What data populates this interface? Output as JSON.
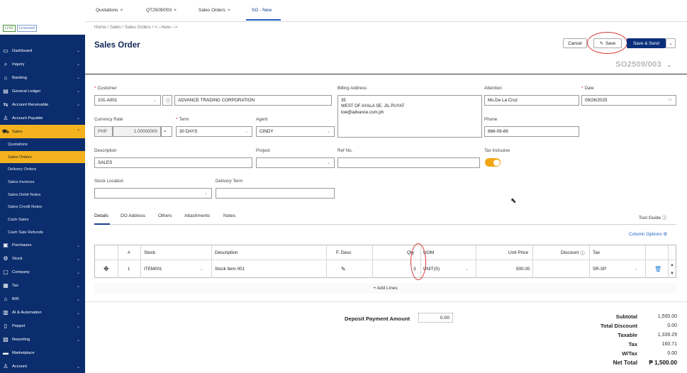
{
  "top_tabs": [
    {
      "label": "Quotations",
      "close": "×"
    },
    {
      "label": "QT2509/003",
      "close": "×"
    },
    {
      "label": "Sales Orders",
      "close": "×"
    },
    {
      "label": "SO - New"
    }
  ],
  "sidebar": {
    "badges": [
      "LIVE",
      "Licensed"
    ],
    "items": [
      {
        "label": "Dashboard",
        "icon": "dashboard-icon"
      },
      {
        "label": "Inquiry",
        "icon": "inquiry-icon"
      },
      {
        "label": "Banking",
        "icon": "bank-icon"
      },
      {
        "label": "General Ledger",
        "icon": "ledger-icon"
      },
      {
        "label": "Account Receivable",
        "icon": "receivable-icon"
      },
      {
        "label": "Account Payable",
        "icon": "payable-icon"
      },
      {
        "label": "Sales",
        "icon": "cart-icon"
      }
    ],
    "sales_sub": [
      "Quotations",
      "Sales Orders",
      "Delivery Orders",
      "Sales Invoices",
      "Sales Debit Notes",
      "Sales Credit Notes",
      "Cash Sales",
      "Cash Sale Refunds"
    ],
    "items_after": [
      {
        "label": "Purchases",
        "icon": "purchases-icon"
      },
      {
        "label": "Stock",
        "icon": "stock-icon"
      },
      {
        "label": "Company",
        "icon": "company-icon"
      },
      {
        "label": "Tax",
        "icon": "tax-icon"
      },
      {
        "label": "BIR",
        "icon": "bir-icon"
      },
      {
        "label": "AI & Automation",
        "icon": "automation-icon"
      },
      {
        "label": "Peppol",
        "icon": "peppol-icon"
      },
      {
        "label": "Reporting",
        "icon": "reporting-icon"
      },
      {
        "label": "Marketplace",
        "icon": "marketplace-icon"
      },
      {
        "label": "Account",
        "icon": "account-icon"
      }
    ]
  },
  "header": {
    "breadcrumb": "Home  /  Sales  /  Sales Orders  /  <---New--->",
    "title": "Sales Order",
    "cancel": "Cancel",
    "save": "Save",
    "save_send": "Save & Send",
    "doc_no": "SO2509/003"
  },
  "form": {
    "customer_label": "Customer",
    "customer_code": "101-A001",
    "customer_name": "ADVANCE TRADING CORPORATION",
    "billing_label": "Billing Address",
    "billing_lines": [
      "35",
      "WEST OF AYALA SE. JIL PUYAT",
      "low@advance.com.ph"
    ],
    "attention_label": "Attention",
    "attention": "Ms.De La Cruz",
    "date_label": "Date",
    "date": "09/26/2025",
    "currency_label": "Currency Rate",
    "currency": "PHP",
    "rate": "1.00000000",
    "term_label": "Term",
    "term": "30 DAYS",
    "agent_label": "Agent",
    "agent": "CINDY",
    "phone_label": "Phone",
    "phone": "866-09-89",
    "description_label": "Description",
    "description": "SALES",
    "project_label": "Project",
    "project": "",
    "refno_label": "Ref No.",
    "refno": "",
    "tax_inclusive_label": "Tax Inclusive",
    "tax_inclusive": true,
    "stock_location_label": "Stock Location",
    "stock_location": "",
    "delivery_term_label": "Delivery Term",
    "delivery_term": ""
  },
  "detail_tabs": [
    "Details",
    "DO Address",
    "Others",
    "Attachments",
    "Notes"
  ],
  "tool_guide": "Tool Guide",
  "column_options": "Column Options",
  "grid": {
    "headers": {
      "no": "#",
      "stock": "Stock",
      "description": "Description",
      "fdesc": "F. Desc",
      "qty": "Qty",
      "uom": "UOM",
      "unit_price": "Unit Price",
      "discount": "Discount",
      "tax": "Tax"
    },
    "rows": [
      {
        "no": "1",
        "stock": "ITEM001",
        "description": "Stock Item 001",
        "qty": "3",
        "uom": "UNIT(S)",
        "unit_price": "500.00",
        "discount": "",
        "tax": "SR-SP"
      }
    ],
    "add_lines": "+  Add Lines"
  },
  "deposit": {
    "label": "Deposit Payment Amount",
    "value": "0.00"
  },
  "totals": [
    {
      "label": "Subtotal",
      "value": "1,500.00"
    },
    {
      "label": "Total Discount",
      "value": "0.00"
    },
    {
      "label": "Taxable",
      "value": "1,339.29"
    },
    {
      "label": "Tax",
      "value": "160.71"
    },
    {
      "label": "W/Tax",
      "value": "0.00"
    },
    {
      "label": "Net Total",
      "value": "₱ 1,500.00"
    }
  ]
}
